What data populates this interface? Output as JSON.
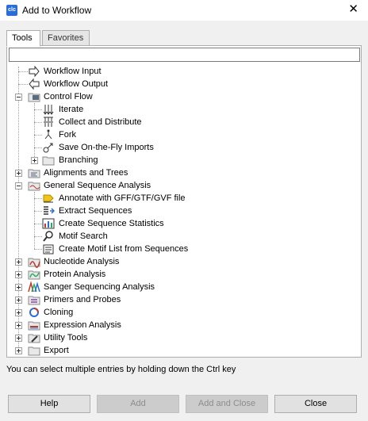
{
  "window": {
    "title": "Add to Workflow",
    "icon_text": "clc"
  },
  "tabs": [
    {
      "label": "Tools",
      "active": true
    },
    {
      "label": "Favorites",
      "active": false
    }
  ],
  "search": {
    "value": "",
    "placeholder": ""
  },
  "tree": {
    "workflow_input": "Workflow Input",
    "workflow_output": "Workflow Output",
    "control_flow": {
      "label": "Control Flow",
      "children": [
        "Iterate",
        "Collect and Distribute",
        "Fork",
        "Save On-the-Fly Imports",
        "Branching"
      ]
    },
    "alignments": "Alignments and Trees",
    "general_sequence": {
      "label": "General Sequence Analysis",
      "children": [
        "Annotate with GFF/GTF/GVF file",
        "Extract Sequences",
        "Create Sequence Statistics",
        "Motif Search",
        "Create Motif List from Sequences"
      ]
    },
    "categories": [
      "Nucleotide Analysis",
      "Protein Analysis",
      "Sanger Sequencing Analysis",
      "Primers and Probes",
      "Cloning",
      "Expression Analysis",
      "Utility Tools",
      "Export"
    ]
  },
  "hint": "You can select multiple entries by holding down the Ctrl key",
  "buttons": {
    "help": "Help",
    "add": "Add",
    "add_and_close": "Add and Close",
    "close": "Close"
  }
}
